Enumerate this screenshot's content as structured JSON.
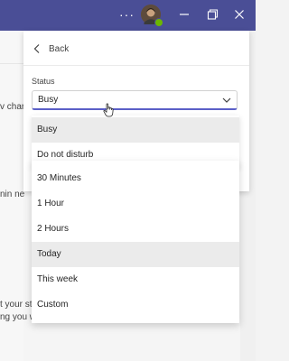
{
  "titlebar": {
    "more_label": "···",
    "avatar_status_color": "#6bb700",
    "accent": "#4a4e96"
  },
  "background": {
    "frag1": "v char",
    "frag2": "nin ne",
    "frag3": "t your st",
    "frag4": "ng you w"
  },
  "panel": {
    "back_label": "Back",
    "status_label": "Status",
    "status_value": "Busy"
  },
  "dropdown": {
    "status_options": [
      "Busy",
      "Do not disturb"
    ],
    "duration_options": [
      "30 Minutes",
      "1 Hour",
      "2 Hours",
      "Today",
      "This week",
      "Custom"
    ]
  }
}
